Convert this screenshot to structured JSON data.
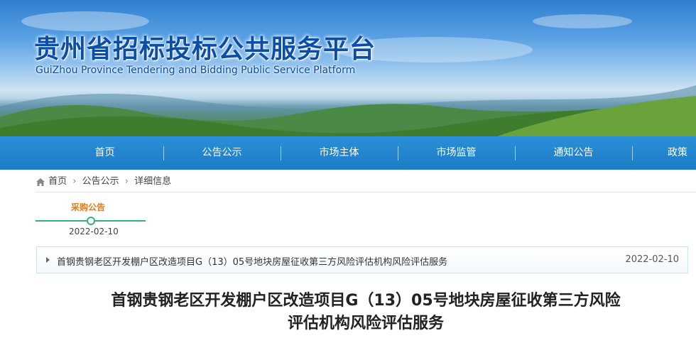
{
  "header": {
    "title": "贵州省招标投标公共服务平台",
    "subtitle": "GuiZhou Province Tendering and Bidding Public Service Platform"
  },
  "nav": {
    "items": [
      {
        "label": "首页"
      },
      {
        "label": "公告公示"
      },
      {
        "label": "市场主体"
      },
      {
        "label": "市场监管"
      },
      {
        "label": "通知公告"
      },
      {
        "label": "政策法"
      }
    ]
  },
  "breadcrumb": {
    "home_icon": "home-icon",
    "home": "首页",
    "sep1": "›",
    "level2": "公告公示",
    "sep2": "›",
    "level3": "详细信息"
  },
  "timeline": {
    "label": "采购公告",
    "date": "2022-02-10"
  },
  "notice": {
    "title": "首钢贵钢老区开发棚户区改造项目G（13）05号地块房屋征收第三方风险评估机构风险评估服务",
    "date": "2022-02-10"
  },
  "article": {
    "title_line1": "首钢贵钢老区开发棚户区改造项目G（13）05号地块房屋征收第三方风险",
    "title_line2": "评估机构风险评估服务"
  }
}
